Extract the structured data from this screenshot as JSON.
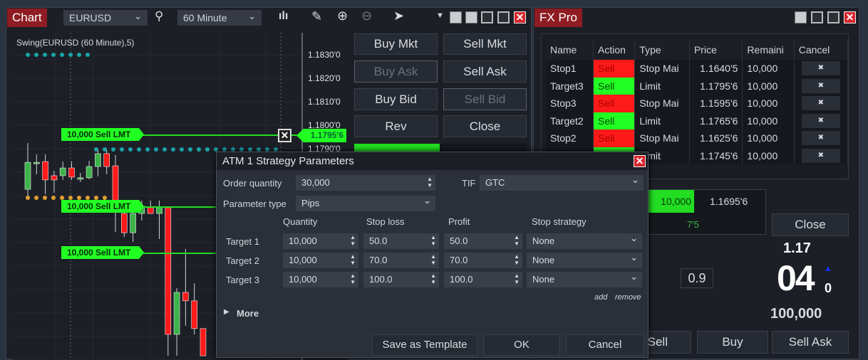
{
  "chart": {
    "tab": "Chart",
    "symbol": "EURUSD",
    "interval": "60 Minute",
    "indicator": "Swing(EURUSD (60 Minute),5)",
    "axis": [
      "1.1830'0",
      "1.1820'0",
      "1.1810'0",
      "1.1800'0",
      "1.1790'0"
    ],
    "current_price": "1.1795'6",
    "orders": [
      {
        "label": "10,000  Sell LMT"
      },
      {
        "label": "10,000  Sell LMT"
      },
      {
        "label": "10,000  Sell LMT"
      }
    ],
    "candles": [
      [
        1.17727,
        1.17924,
        1.177,
        1.17842
      ],
      [
        1.17842,
        1.17876,
        1.17791,
        1.17842
      ],
      [
        1.17845,
        1.17876,
        1.17706,
        1.17767
      ],
      [
        1.17785,
        1.17806,
        1.17712,
        1.17767
      ],
      [
        1.17785,
        1.17845,
        1.17767,
        1.17818
      ],
      [
        1.17818,
        1.17845,
        1.17767,
        1.17779
      ],
      [
        1.17776,
        1.17797,
        1.17758,
        1.17776
      ],
      [
        1.17776,
        1.17848,
        1.1777,
        1.17824
      ],
      [
        1.17824,
        1.17894,
        1.17782,
        1.17879
      ],
      [
        1.17879,
        1.17894,
        1.17791,
        1.17824
      ],
      [
        1.17827,
        1.17873,
        1.17545,
        1.17655
      ],
      [
        1.17624,
        1.17655,
        1.17524,
        1.17542
      ],
      [
        1.17542,
        1.17655,
        1.17503,
        1.17624
      ],
      [
        1.17624,
        1.17679,
        1.17594,
        1.17655
      ],
      [
        1.17649,
        1.17679,
        1.17624,
        1.17624
      ],
      [
        1.17624,
        1.17679,
        1.17515,
        1.17649
      ],
      [
        1.17649,
        1.17649,
        1.17018,
        1.17109
      ],
      [
        1.17109,
        1.17306,
        1.17018,
        1.17288
      ],
      [
        1.17288,
        1.17473,
        1.17146,
        1.17252
      ],
      [
        1.17252,
        1.17327,
        1.17109,
        1.17134
      ],
      [
        1.17134,
        1.17134,
        1.17018,
        1.17018
      ]
    ],
    "colors": {
      "up": "#3db34a",
      "down": "#ff1a1a",
      "order": "#22ff22",
      "swing_high": "#1aa3a8",
      "swing_low": "#e0a030"
    },
    "buttons": [
      "Buy Mkt",
      "Sell Mkt",
      "Buy Ask",
      "Sell Ask",
      "Buy Bid",
      "Sell Bid",
      "Rev",
      "Close"
    ]
  },
  "fxpro": {
    "tab": "FX Pro",
    "columns": [
      "Name",
      "Action",
      "Type",
      "Price",
      "Remaini",
      "Cancel"
    ],
    "rows": [
      {
        "name": "Stop1",
        "action": "Sell",
        "color": "r",
        "type": "Stop Mai",
        "price": "1.1640'5",
        "rem": "10,000"
      },
      {
        "name": "Target3",
        "action": "Sell",
        "color": "g",
        "type": "Limit",
        "price": "1.1795'6",
        "rem": "10,000"
      },
      {
        "name": "Stop3",
        "action": "Sell",
        "color": "r",
        "type": "Stop Mai",
        "price": "1.1595'6",
        "rem": "10,000"
      },
      {
        "name": "Target2",
        "action": "Sell",
        "color": "g",
        "type": "Limit",
        "price": "1.1765'6",
        "rem": "10,000"
      },
      {
        "name": "Stop2",
        "action": "Sell",
        "color": "r",
        "type": "Stop Mai",
        "price": "1.1625'6",
        "rem": "10,000"
      },
      {
        "name": "",
        "action": "",
        "color": "g",
        "type": "Limit",
        "price": "1.1745'6",
        "rem": "10,000"
      }
    ],
    "cancel_glyph": "✖",
    "position_qty": "10,000",
    "position_price": "1.1695'6",
    "pnl": "7'5",
    "close": "Close",
    "spread": "0.9",
    "price_big_prefix": "1.17",
    "price_big": "04",
    "price_small": "0",
    "size": "100,000",
    "bottom_buttons": [
      "Sell",
      "Buy",
      "Sell Ask"
    ]
  },
  "dialog": {
    "title": "ATM 1 Strategy Parameters",
    "order_qty_label": "Order quantity",
    "order_qty": "30,000",
    "tif_label": "TIF",
    "tif": "GTC",
    "param_type_label": "Parameter type",
    "param_type": "Pips",
    "headers": [
      "Quantity",
      "Stop loss",
      "Profit",
      "Stop strategy"
    ],
    "targets": [
      {
        "name": "Target 1",
        "qty": "10,000",
        "sl": "50.0",
        "profit": "50.0",
        "strategy": "None"
      },
      {
        "name": "Target 2",
        "qty": "10,000",
        "sl": "70.0",
        "profit": "70.0",
        "strategy": "None"
      },
      {
        "name": "Target 3",
        "qty": "10,000",
        "sl": "100.0",
        "profit": "100.0",
        "strategy": "None"
      }
    ],
    "add": "add",
    "remove": "remove",
    "more": "More",
    "save": "Save as Template",
    "ok": "OK",
    "cancel": "Cancel"
  }
}
